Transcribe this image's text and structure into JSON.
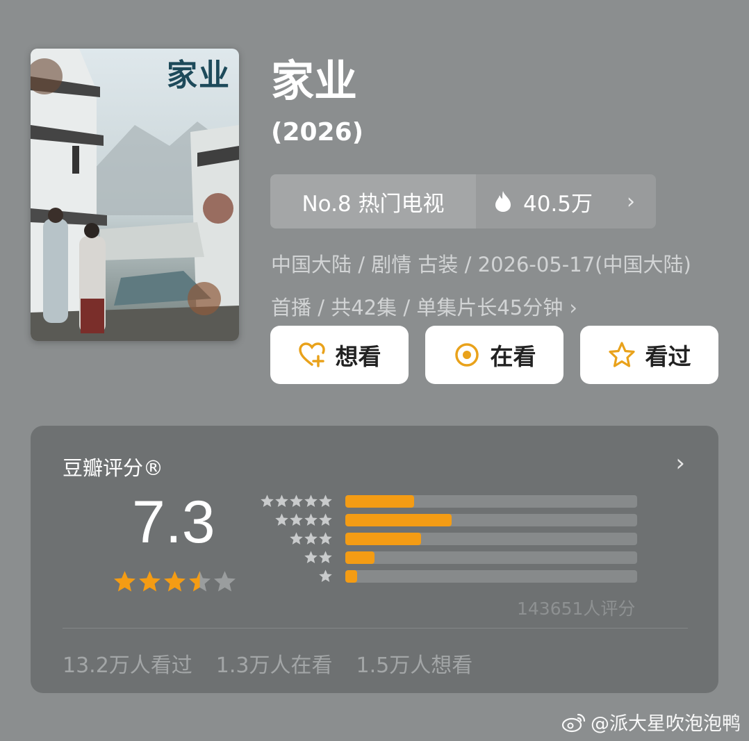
{
  "poster": {
    "title_text": "家业"
  },
  "show": {
    "title": "家业",
    "year": "(2026)"
  },
  "rank": {
    "label": "No.8 热门电视",
    "heat": "40.5万",
    "chevron": "›"
  },
  "meta": {
    "info": "中国大陆 / 剧情 古装 / 2026-05-17(中国大陆)首播 / 共42集 / 单集片长45分钟 ›"
  },
  "actions": [
    {
      "label": "想看",
      "icon": "heart-plus-icon"
    },
    {
      "label": "在看",
      "icon": "target-icon"
    },
    {
      "label": "看过",
      "icon": "star-outline-icon"
    }
  ],
  "rating": {
    "title": "豆瓣评分®",
    "chevron": "›",
    "score": "7.3",
    "stars_filled": 3.5,
    "star_total": 5,
    "distribution_fraction_of_bar": [
      0.235,
      0.365,
      0.26,
      0.1,
      0.04
    ],
    "count_label": "143651人评分",
    "stats": [
      "13.2万人看过",
      "1.3万人在看",
      "1.5万人想看"
    ]
  },
  "colors": {
    "accent": "#f49c14",
    "background": "#8b8e8f",
    "card": "#6e7172"
  },
  "watermark": {
    "text": "@派大星吹泡泡鸭",
    "icon": "weibo-icon"
  }
}
